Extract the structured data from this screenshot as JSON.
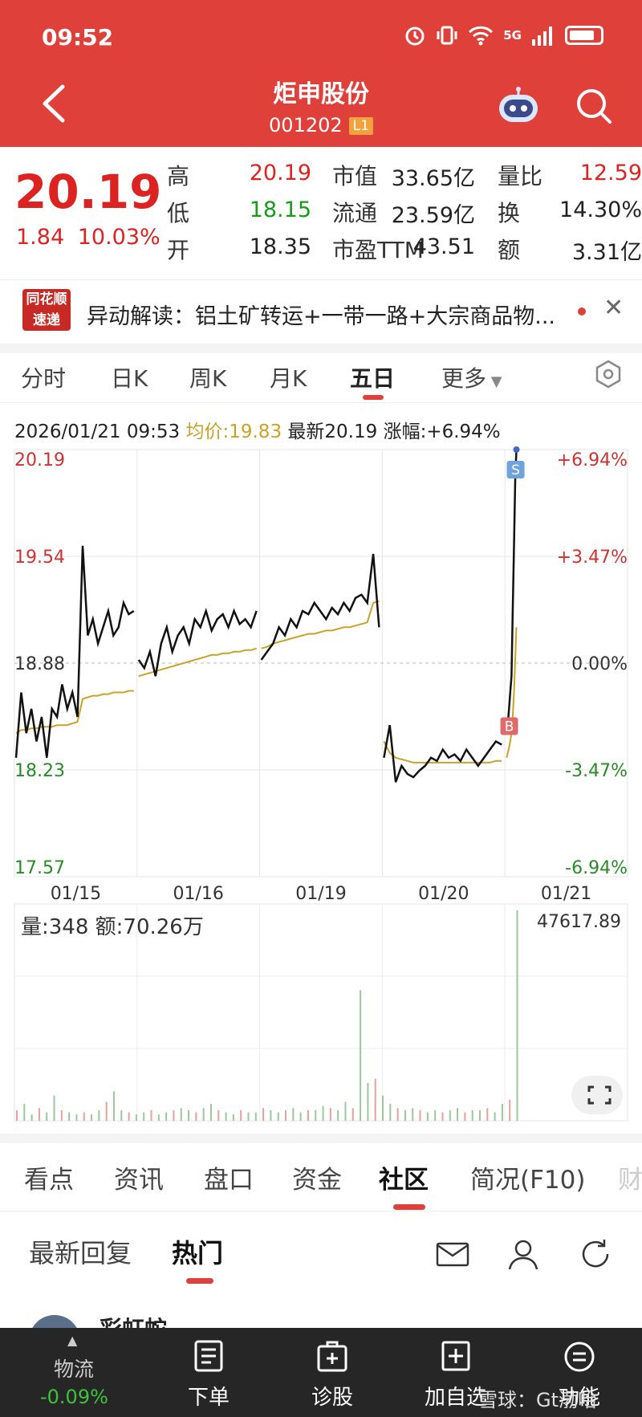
{
  "status": {
    "time": "09:52",
    "network": "5G"
  },
  "header": {
    "title": "炬申股份",
    "code": "001202",
    "level": "L1"
  },
  "quote": {
    "price": "20.19",
    "change": "1.84",
    "change_pct": "10.03%",
    "stats": [
      {
        "label": "高",
        "value": "20.19",
        "color": "#d22"
      },
      {
        "label": "低",
        "value": "18.15",
        "color": "#1a9a1a"
      },
      {
        "label": "开",
        "value": "18.35",
        "color": "#222"
      },
      {
        "label": "市值",
        "value": "33.65亿",
        "color": "#222"
      },
      {
        "label": "流通",
        "value": "23.59亿",
        "color": "#222"
      },
      {
        "label": "市盈TTM",
        "value": "43.51",
        "color": "#222"
      },
      {
        "label": "量比",
        "value": "12.59",
        "color": "#d22"
      },
      {
        "label": "换",
        "value": "14.30%",
        "color": "#222"
      },
      {
        "label": "额",
        "value": "3.31亿",
        "color": "#222"
      }
    ]
  },
  "news": {
    "logo_line1": "同花顺",
    "logo_line2": "速递",
    "text": "异动解读：铝土矿转运+一带一路+大宗商品物..."
  },
  "kline_tabs": [
    "分时",
    "日K",
    "周K",
    "月K",
    "五日",
    "更多"
  ],
  "kline_active": "五日",
  "chart_info": {
    "datetime": "2026/01/21 09:53",
    "avg_label": "均价:19.83",
    "latest_label": "最新20.19",
    "change_label": "涨幅:+6.94%"
  },
  "chart_data": {
    "type": "line",
    "price_ticks": [
      "20.19",
      "19.54",
      "18.88",
      "18.23",
      "17.57"
    ],
    "pct_ticks": [
      "+6.94%",
      "+3.47%",
      "0.00%",
      "-3.47%",
      "-6.94%"
    ],
    "ylim": [
      17.57,
      20.19
    ],
    "prev_close": 18.88,
    "x_labels": [
      "01/15",
      "01/16",
      "01/19",
      "01/20",
      "01/21"
    ],
    "series": [
      {
        "color": "#111",
        "values": [
          18.3,
          18.7,
          18.45,
          18.6,
          18.4,
          18.55,
          18.3,
          18.6,
          18.55,
          18.75,
          18.6,
          18.7,
          18.55,
          19.6,
          19.05,
          19.15,
          19.0,
          19.1,
          19.2,
          19.05,
          19.1,
          19.25,
          19.18,
          19.2,
          18.9,
          18.85,
          18.95,
          18.8,
          19.0,
          19.1,
          18.95,
          19.05,
          19.1,
          19.0,
          19.15,
          19.1,
          19.2,
          19.08,
          19.15,
          19.18,
          19.1,
          19.2,
          19.12,
          19.15,
          19.1,
          19.2,
          18.9,
          18.95,
          19.0,
          19.1,
          19.05,
          19.15,
          19.1,
          19.2,
          19.18,
          19.25,
          19.2,
          19.15,
          19.22,
          19.18,
          19.25,
          19.2,
          19.28,
          19.3,
          19.25,
          19.55,
          19.1,
          18.3,
          18.5,
          18.15,
          18.25,
          18.2,
          18.18,
          18.22,
          18.25,
          18.3,
          18.28,
          18.35,
          18.3,
          18.32,
          18.28,
          18.35,
          18.3,
          18.25,
          18.3,
          18.35,
          18.4,
          18.38,
          18.45,
          18.5,
          18.6,
          18.7,
          18.8,
          19.2,
          19.6,
          20.0,
          20.19
        ]
      },
      {
        "color": "#c9a227",
        "values": [
          18.45,
          18.47,
          18.47,
          18.48,
          18.48,
          18.49,
          18.49,
          18.49,
          18.5,
          18.5,
          18.5,
          18.51,
          18.52,
          18.66,
          18.67,
          18.68,
          18.68,
          18.69,
          18.69,
          18.7,
          18.7,
          18.7,
          18.71,
          18.71,
          18.8,
          18.81,
          18.82,
          18.83,
          18.84,
          18.85,
          18.86,
          18.87,
          18.88,
          18.89,
          18.9,
          18.91,
          18.92,
          18.93,
          18.93,
          18.94,
          18.94,
          18.95,
          18.95,
          18.96,
          18.96,
          18.97,
          18.97,
          18.98,
          19.0,
          19.01,
          19.02,
          19.03,
          19.04,
          19.05,
          19.06,
          19.06,
          19.07,
          19.08,
          19.08,
          19.09,
          19.1,
          19.1,
          19.11,
          19.12,
          19.13,
          19.25,
          19.26,
          18.4,
          18.33,
          18.3,
          18.29,
          18.28,
          18.27,
          18.27,
          18.27,
          18.27,
          18.27,
          18.27,
          18.27,
          18.27,
          18.27,
          18.27,
          18.27,
          18.27,
          18.27,
          18.27,
          18.28,
          18.28,
          18.3,
          18.33,
          18.36,
          18.4,
          18.45,
          18.55,
          18.7,
          18.9,
          19.1
        ]
      }
    ],
    "markers": [
      {
        "label": "S",
        "color": "#6fa3dc"
      },
      {
        "label": "B",
        "color": "#e06a6a"
      }
    ],
    "volume": {
      "label": "量:348",
      "amount": "额:70.26万",
      "max": "47617.89",
      "values": [
        0.05,
        0.08,
        0.03,
        0.06,
        0.04,
        0.12,
        0.05,
        0.04,
        0.03,
        0.04,
        0.03,
        0.05,
        0.09,
        0.14,
        0.05,
        0.04,
        0.03,
        0.04,
        0.05,
        0.03,
        0.04,
        0.05,
        0.06,
        0.05,
        0.04,
        0.06,
        0.08,
        0.05,
        0.04,
        0.03,
        0.05,
        0.04,
        0.04,
        0.06,
        0.05,
        0.04,
        0.05,
        0.06,
        0.04,
        0.05,
        0.05,
        0.07,
        0.06,
        0.05,
        0.09,
        0.06,
        0.62,
        0.18,
        0.2,
        0.12,
        0.08,
        0.06,
        0.05,
        0.06,
        0.05,
        0.04,
        0.05,
        0.04,
        0.05,
        0.06,
        0.04,
        0.05,
        0.05,
        0.06,
        0.04,
        0.08,
        0.1,
        1.0
      ]
    }
  },
  "bottom_tabs": [
    "看点",
    "资讯",
    "盘口",
    "资金",
    "社区",
    "简况(F10)",
    "财"
  ],
  "bottom_tab_active": "社区",
  "sub_tabs": [
    "最新回复",
    "热门"
  ],
  "sub_tab_active": "热门",
  "post": {
    "username": "彩虹蛇"
  },
  "bottom_nav": {
    "watchlist_name": "物流",
    "watchlist_change": "-0.09%",
    "items": [
      "下单",
      "诊股",
      "加自选",
      "功能"
    ],
    "watermark": "雪球：Gt渤咍"
  }
}
